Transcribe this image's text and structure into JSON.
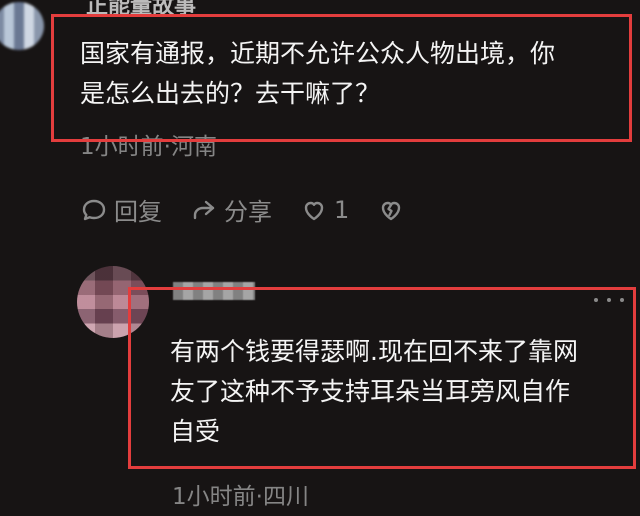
{
  "top_comment": {
    "username": "正能量故事",
    "text": "国家有通报，近期不允许公众人物出境，你\n是怎么出去的？去干嘛了？",
    "meta": "1小时前·河南"
  },
  "actions": {
    "reply_label": "回复",
    "share_label": "分享",
    "like_count": "1"
  },
  "reply": {
    "text": "有两个钱要得瑟啊.现在回不来了靠网\n友了这种不予支持耳朵当耳旁风自作\n自受",
    "meta": "1小时前·四川"
  },
  "icons": {
    "reply": "reply-icon",
    "share": "share-icon",
    "like": "heart-icon",
    "dislike": "broken-heart-icon",
    "more": "more-icon"
  },
  "colors": {
    "background": "#171414",
    "primary_text": "#f4f4f4",
    "secondary_text": "#858585",
    "action_text": "#8b8b8b",
    "highlight_border": "#e33d3d"
  }
}
